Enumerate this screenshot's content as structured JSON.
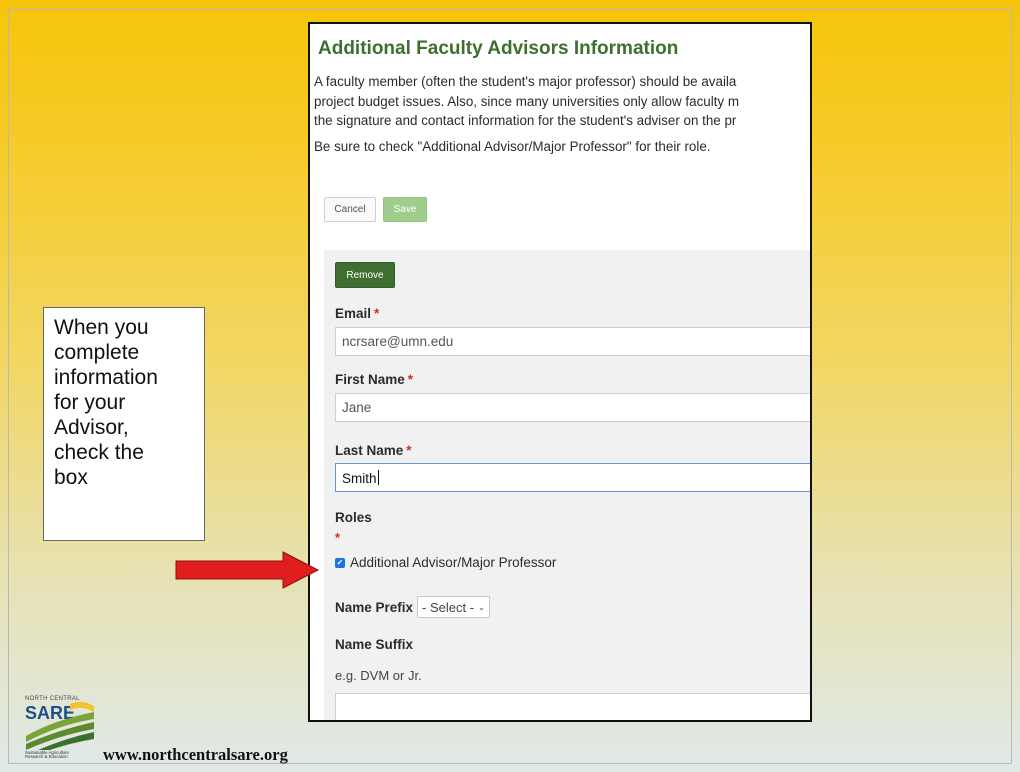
{
  "slide": {
    "callout_lines": [
      "When you",
      "complete",
      "information",
      "for your",
      "Advisor,",
      "check the",
      "box"
    ],
    "website": "www.northcentralsare.org",
    "logo": {
      "top_text": "NORTH CENTRAL",
      "mark": "SARE",
      "sub_line1": "Sustainable Agriculture",
      "sub_line2": "Research & Education"
    },
    "arrow_color": "#e21d1d",
    "background_colors": [
      "#f6c40a",
      "#dfe9e8"
    ]
  },
  "form": {
    "title": "Additional Faculty Advisors Information",
    "intro_lines": [
      "A faculty member (often the student's major professor) should be availa",
      "project budget issues. Also, since many universities only allow faculty m",
      "the signature and contact information for the student's adviser on the pr"
    ],
    "instruction": "Be sure to check \"Additional Advisor/Major Professor\" for their role.",
    "cancel_label": "Cancel",
    "save_label": "Save",
    "remove_label": "Remove",
    "email_label": "Email",
    "email_value": "ncrsare@umn.edu",
    "first_name_label": "First Name",
    "first_name_value": "Jane",
    "last_name_label": "Last Name",
    "last_name_value": "Smith",
    "roles_label": "Roles",
    "required_marker": "*",
    "role_option_label": "Additional Advisor/Major Professor",
    "role_option_checked": true,
    "name_prefix_label": "Name Prefix",
    "name_prefix_selected": "- Select -",
    "name_suffix_label": "Name Suffix",
    "name_suffix_help": "e.g. DVM or Jr.",
    "name_suffix_value": "",
    "accent_color": "#3e6f31",
    "required_color": "#d52b1e"
  }
}
